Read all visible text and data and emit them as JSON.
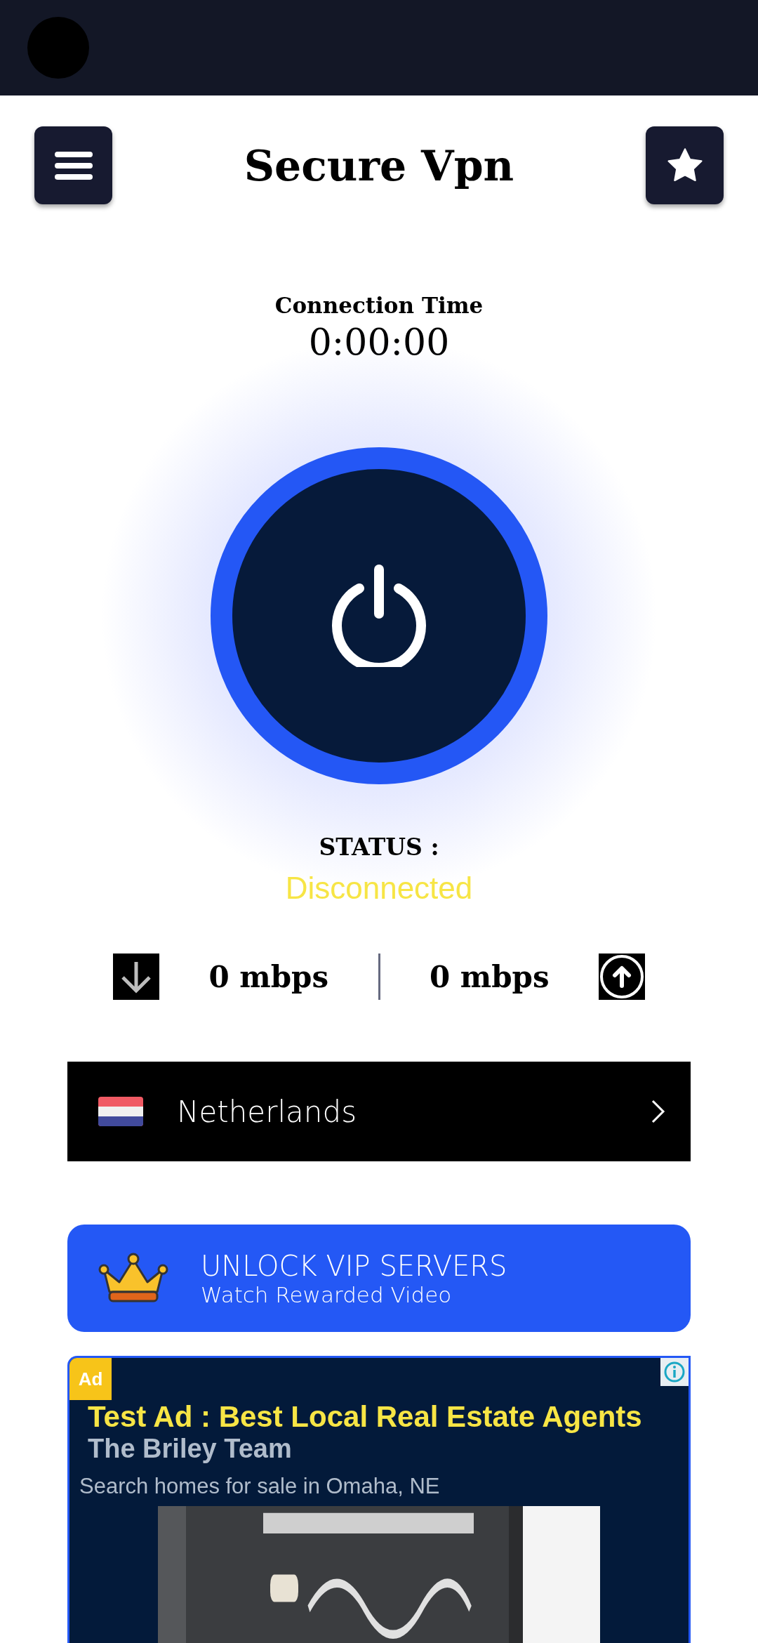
{
  "header": {
    "title": "Secure Vpn"
  },
  "connection": {
    "label": "Connection Time",
    "time": "0:00:00"
  },
  "status": {
    "label": "STATUS :",
    "value": "Disconnected"
  },
  "speeds": {
    "download": "0 mbps",
    "upload": "0 mbps"
  },
  "server": {
    "country": "Netherlands"
  },
  "vip": {
    "title": "UNLOCK VIP SERVERS",
    "subtitle": "Watch Rewarded Video"
  },
  "ad": {
    "badge": "Ad",
    "headline": "Test Ad : Best Local Real Estate Agents",
    "advertiser": "The Briley Team",
    "description": "Search homes for sale in Omaha, NE"
  }
}
